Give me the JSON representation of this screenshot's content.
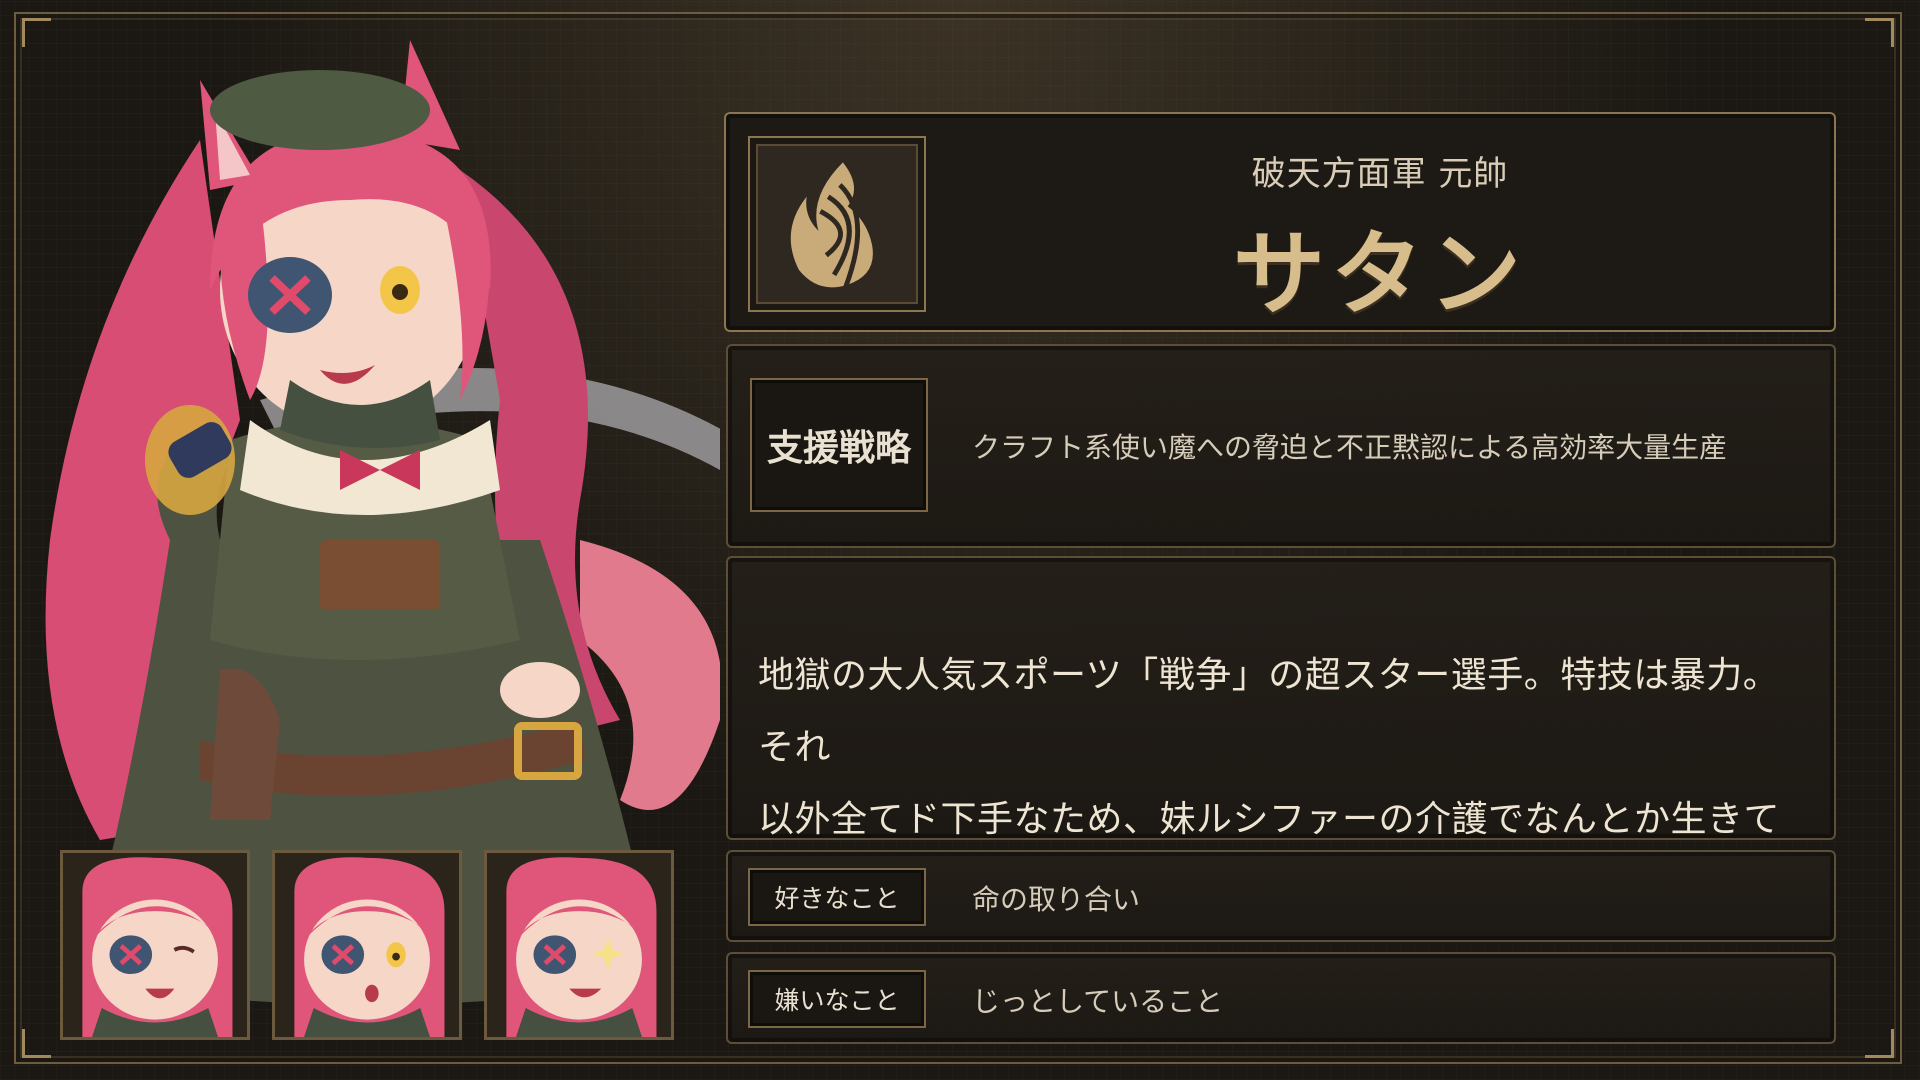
{
  "profile": {
    "affiliation": "破天方面軍 元帥",
    "name": "サタン",
    "emblem_icon": "flame-emblem-icon",
    "strategy_label": "支援戦略",
    "strategy_text": "クラフト系使い魔への脅迫と不正黙認による高効率大量生産",
    "description_line1": "地獄の大人気スポーツ「戦争」の超スター選手。特技は暴力。それ",
    "description_line2": "以外全てド下手なため、妹ルシファーの介護でなんとか生きている。",
    "likes_label": "好きなこと",
    "likes_text": "命の取り合い",
    "dislikes_label": "嫌いなこと",
    "dislikes_text": "じっとしていること"
  },
  "expressions": [
    {
      "icon": "expression-crying-icon"
    },
    {
      "icon": "expression-worried-icon"
    },
    {
      "icon": "expression-sparkle-icon"
    }
  ],
  "colors": {
    "accent_gold": "#d8bd8c",
    "frame_border": "#8c7650",
    "hair_pink": "#e0557a",
    "outfit_green": "#4d5340"
  }
}
